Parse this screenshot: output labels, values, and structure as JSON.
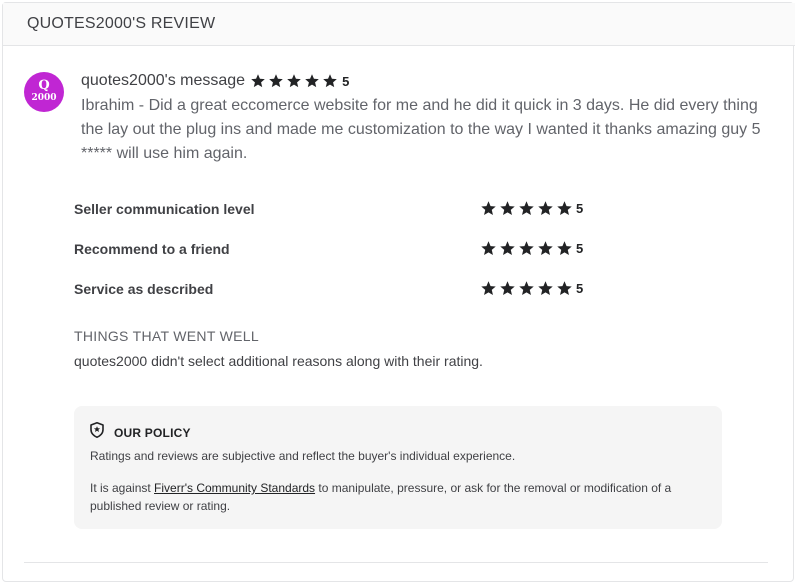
{
  "header": {
    "title": "QUOTES2000'S REVIEW"
  },
  "avatar": {
    "line1": "Q",
    "line2": "2000"
  },
  "message": {
    "author": "quotes2000's message",
    "rating": "5",
    "body": "Ibrahim - Did a great eccomerce website for me and he did it quick in 3 days. He did every thing the lay out the plug ins and made me customization to the way I wanted it thanks amazing guy 5 ***** will use him again."
  },
  "criteria": [
    {
      "label": "Seller communication level",
      "value": "5"
    },
    {
      "label": "Recommend to a friend",
      "value": "5"
    },
    {
      "label": "Service as described",
      "value": "5"
    }
  ],
  "went_well": {
    "title": "THINGS THAT WENT WELL",
    "text": "quotes2000 didn't select additional reasons along with their rating."
  },
  "policy": {
    "title": "OUR POLICY",
    "p1": "Ratings and reviews are subjective and reflect the buyer's individual experience.",
    "p2_before": "It is against ",
    "p2_link": "Fiverr's Community Standards",
    "p2_after": " to manipulate, pressure, or ask for the removal or modification of a published review or rating."
  },
  "colors": {
    "star": "#222325",
    "avatar_bg": "#c026d3",
    "panel_bg": "#f5f5f5"
  },
  "icons": {
    "rating": "star-icon",
    "policy": "shield-star-icon"
  }
}
